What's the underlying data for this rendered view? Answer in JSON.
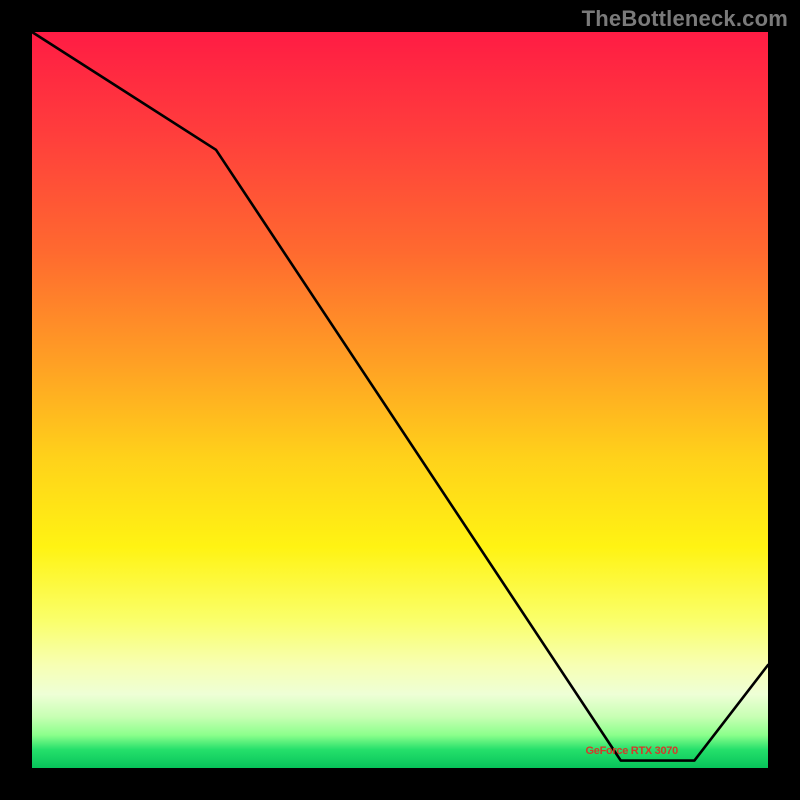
{
  "watermark": "TheBottleneck.com",
  "chart_data": {
    "type": "line",
    "title": "",
    "xlabel": "",
    "ylabel": "",
    "xlim": [
      0,
      100
    ],
    "ylim": [
      0,
      100
    ],
    "x": [
      0,
      25,
      80,
      90,
      100
    ],
    "values": [
      100,
      84,
      1,
      1,
      14
    ],
    "annotation": {
      "text": "GeForce RTX 3070",
      "x": 82,
      "y": 2
    },
    "gradient_stops": [
      {
        "pos": 0,
        "color": "#ff1c44"
      },
      {
        "pos": 0.7,
        "color": "#fff313"
      },
      {
        "pos": 0.97,
        "color": "#25e06b"
      },
      {
        "pos": 1.0,
        "color": "#07c35a"
      }
    ]
  }
}
